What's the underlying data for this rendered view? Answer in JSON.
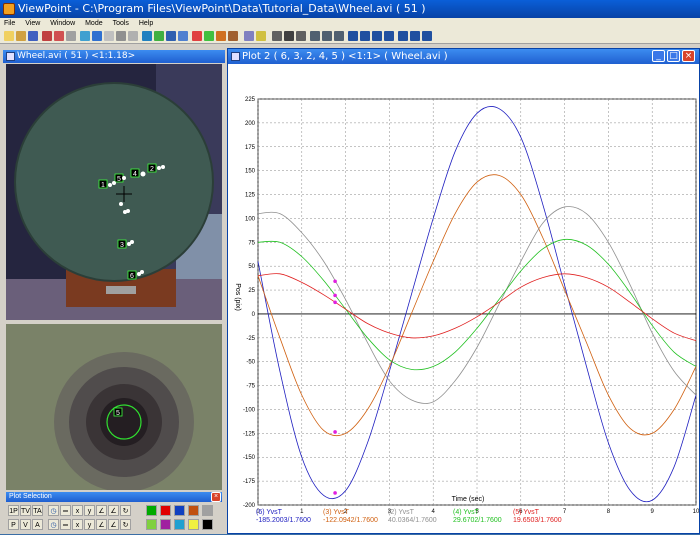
{
  "window": {
    "title": "ViewPoint - C:\\Program Files\\ViewPoint\\Data\\Tutorial_Data\\Wheel.avi ( 51 )"
  },
  "menu": [
    "File",
    "View",
    "Window",
    "Mode",
    "Tools",
    "Help"
  ],
  "video_panel": {
    "title": "Wheel.avi ( 51 ) <1:1.18>"
  },
  "markers": [
    "1",
    "2",
    "3",
    "4",
    "5",
    "6"
  ],
  "zoom_panel": {
    "marker": "5"
  },
  "plot_selection": {
    "title": "Plot Selection",
    "row1": [
      "1P",
      "TV",
      "TA"
    ],
    "row2": [
      "P",
      "V",
      "A"
    ],
    "swatches_row1": [
      "#00aa00",
      "#e00000",
      "#1040c0",
      "#c05010",
      "#a0a0a0"
    ],
    "swatches_row2": [
      "#80d040",
      "#a020a0",
      "#20a0d0",
      "#f0f040",
      "#000000"
    ]
  },
  "plot_window": {
    "title": "Plot 2 ( 6, 3, 2, 4, 5 ) <1:1> ( Wheel.avi )"
  },
  "chart_data": {
    "type": "line",
    "xlabel": "Time (sec)",
    "ylabel": "Pos (pix)",
    "xlim": [
      0,
      10
    ],
    "ylim": [
      -200,
      225
    ],
    "xticks": [
      0,
      1,
      2,
      3,
      4,
      5,
      6,
      7,
      8,
      9,
      10
    ],
    "yticks": [
      225,
      200,
      175,
      150,
      125,
      100,
      75,
      50,
      25,
      0,
      -25,
      -50,
      -75,
      -100,
      -125,
      -150,
      -175,
      -200
    ],
    "grid": true,
    "cursor_x": 1.76,
    "series": [
      {
        "name": "(6) YvsT",
        "color": "#2020c0",
        "readout": "-185.2003/1.7600",
        "x": [
          0,
          0.5,
          1,
          1.5,
          2,
          2.5,
          3,
          3.5,
          4,
          4.5,
          5,
          5.5,
          6,
          6.5,
          7,
          7.5,
          8,
          8.5,
          9,
          9.5,
          10
        ],
        "y": [
          55,
          -60,
          -150,
          -190,
          -185,
          -135,
          -60,
          20,
          100,
          170,
          210,
          215,
          185,
          115,
          30,
          -55,
          -135,
          -185,
          -195,
          -160,
          -85
        ]
      },
      {
        "name": "(3) YvsT",
        "color": "#d06010",
        "readout": "-122.0942/1.7600",
        "x": [
          0,
          0.5,
          1,
          1.5,
          2,
          2.5,
          3,
          3.5,
          4,
          4.5,
          5,
          5.5,
          6,
          6.5,
          7,
          7.5,
          8,
          8.5,
          9,
          9.5,
          10
        ],
        "y": [
          40,
          -25,
          -85,
          -122,
          -125,
          -100,
          -55,
          0,
          55,
          105,
          138,
          145,
          125,
          80,
          25,
          -30,
          -85,
          -120,
          -125,
          -100,
          -55
        ]
      },
      {
        "name": "(2) YvsT",
        "color": "#909090",
        "readout": "40.0364/1.7600",
        "x": [
          0,
          0.5,
          1,
          1.5,
          2,
          2.5,
          3,
          3.5,
          4,
          4.5,
          5,
          5.5,
          6,
          6.5,
          7,
          7.5,
          8,
          8.5,
          9,
          9.5,
          10
        ],
        "y": [
          105,
          105,
          85,
          55,
          15,
          -30,
          -70,
          -90,
          -92,
          -70,
          -35,
          10,
          55,
          95,
          112,
          105,
          75,
          30,
          -20,
          -60,
          -85
        ]
      },
      {
        "name": "(4) YvsT",
        "color": "#20c020",
        "readout": "29.6702/1.7600",
        "x": [
          0,
          0.5,
          1,
          1.5,
          2,
          2.5,
          3,
          3.5,
          4,
          4.5,
          5,
          5.5,
          6,
          6.5,
          7,
          7.5,
          8,
          8.5,
          9,
          9.5,
          10
        ],
        "y": [
          75,
          75,
          60,
          35,
          5,
          -25,
          -48,
          -58,
          -55,
          -40,
          -15,
          15,
          45,
          68,
          78,
          72,
          52,
          22,
          -12,
          -40,
          -55
        ]
      },
      {
        "name": "(5) YvsT",
        "color": "#e02020",
        "readout": "19.6503/1.7600",
        "x": [
          0,
          0.5,
          1,
          1.5,
          2,
          2.5,
          3,
          3.5,
          4,
          4.5,
          5,
          5.5,
          6,
          6.5,
          7,
          7.5,
          8,
          8.5,
          9,
          9.5,
          10
        ],
        "y": [
          40,
          42,
          33,
          20,
          5,
          -10,
          -20,
          -25,
          -23,
          -15,
          -3,
          12,
          28,
          38,
          42,
          38,
          28,
          12,
          -5,
          -20,
          -28
        ]
      }
    ]
  }
}
